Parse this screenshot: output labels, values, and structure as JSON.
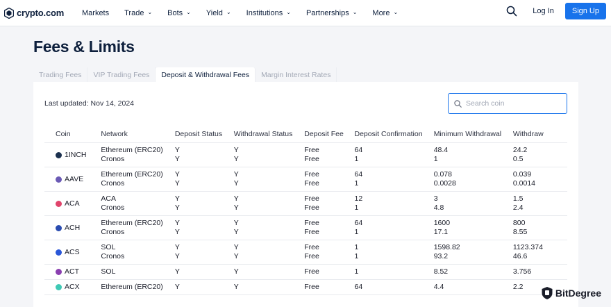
{
  "nav": {
    "brand": "crypto.com",
    "items": [
      {
        "label": "Markets",
        "dropdown": false
      },
      {
        "label": "Trade",
        "dropdown": true
      },
      {
        "label": "Bots",
        "dropdown": true
      },
      {
        "label": "Yield",
        "dropdown": true
      },
      {
        "label": "Institutions",
        "dropdown": true
      },
      {
        "label": "Partnerships",
        "dropdown": true
      },
      {
        "label": "More",
        "dropdown": true
      }
    ],
    "login_label": "Log In",
    "signup_label": "Sign Up"
  },
  "page": {
    "title": "Fees & Limits",
    "tabs": [
      {
        "label": "Trading Fees",
        "active": false
      },
      {
        "label": "VIP Trading Fees",
        "active": false
      },
      {
        "label": "Deposit & Withdrawal Fees",
        "active": true
      },
      {
        "label": "Margin Interest Rates",
        "active": false
      }
    ],
    "last_updated": "Last updated: Nov 14, 2024",
    "search_placeholder": "Search coin"
  },
  "table": {
    "headers": [
      "Coin",
      "Network",
      "Deposit Status",
      "Withdrawal Status",
      "Deposit Fee",
      "Deposit Confirmation",
      "Minimum Withdrawal",
      "Withdraw"
    ],
    "rows": [
      {
        "coin": "1INCH",
        "icon_color": "#1b314f",
        "networks": [
          [
            "Ethereum (ERC20)",
            "Y",
            "Y",
            "Free",
            "64",
            "48.4",
            "24.2"
          ],
          [
            "Cronos",
            "Y",
            "Y",
            "Free",
            "1",
            "1",
            "0.5"
          ]
        ]
      },
      {
        "coin": "AAVE",
        "icon_color": "#6b5ab5",
        "networks": [
          [
            "Ethereum (ERC20)",
            "Y",
            "Y",
            "Free",
            "64",
            "0.078",
            "0.039"
          ],
          [
            "Cronos",
            "Y",
            "Y",
            "Free",
            "1",
            "0.0028",
            "0.0014"
          ]
        ]
      },
      {
        "coin": "ACA",
        "icon_color": "#e0446b",
        "networks": [
          [
            "ACA",
            "Y",
            "Y",
            "Free",
            "12",
            "3",
            "1.5"
          ],
          [
            "Cronos",
            "Y",
            "Y",
            "Free",
            "1",
            "4.8",
            "2.4"
          ]
        ]
      },
      {
        "coin": "ACH",
        "icon_color": "#2a4cb0",
        "networks": [
          [
            "Ethereum (ERC20)",
            "Y",
            "Y",
            "Free",
            "64",
            "1600",
            "800"
          ],
          [
            "Cronos",
            "Y",
            "Y",
            "Free",
            "1",
            "17.1",
            "8.55"
          ]
        ]
      },
      {
        "coin": "ACS",
        "icon_color": "#2a57d8",
        "networks": [
          [
            "SOL",
            "Y",
            "Y",
            "Free",
            "1",
            "1598.82",
            "1123.374"
          ],
          [
            "Cronos",
            "Y",
            "Y",
            "Free",
            "1",
            "93.2",
            "46.6"
          ]
        ]
      },
      {
        "coin": "ACT",
        "icon_color": "#8a3fb0",
        "networks": [
          [
            "SOL",
            "Y",
            "Y",
            "Free",
            "1",
            "8.52",
            "3.756"
          ]
        ]
      },
      {
        "coin": "ACX",
        "icon_color": "#3fc9b5",
        "networks": [
          [
            "Ethereum (ERC20)",
            "Y",
            "Y",
            "Free",
            "64",
            "4.4",
            "2.2"
          ]
        ]
      }
    ]
  },
  "watermark": {
    "text": "BitDegree"
  },
  "colors": {
    "accent": "#1873eb",
    "text": "#0d1f3c",
    "muted": "#a3a9b6"
  }
}
